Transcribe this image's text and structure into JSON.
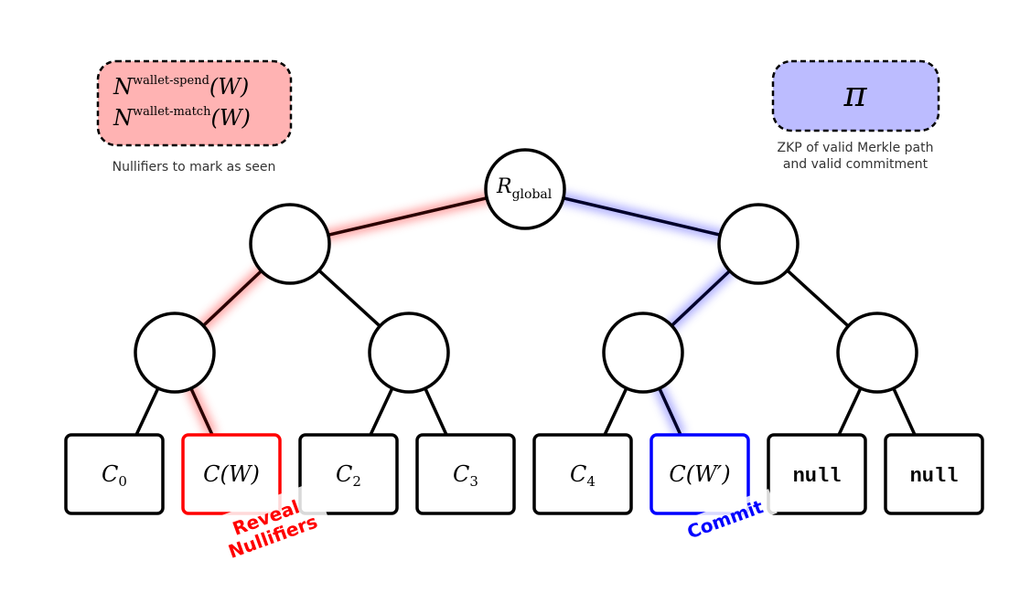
{
  "root": {
    "label_main": "R",
    "label_sub": "global"
  },
  "nullifier_box": {
    "lines": [
      {
        "base": "N",
        "sup": "wallet-spend",
        "arg": "(W)"
      },
      {
        "base": "N",
        "sup": "wallet-match",
        "arg": "(W)"
      }
    ],
    "caption": "Nullifiers to mark as seen",
    "fill": "#ffb3b3"
  },
  "proof_box": {
    "symbol": "π",
    "caption_lines": [
      "ZKP of valid Merkle path",
      "and valid commitment"
    ],
    "fill": "#bcbcff"
  },
  "leaves": [
    {
      "main": "C",
      "sub": "0",
      "style": "math",
      "highlight": "none"
    },
    {
      "main": "C(W)",
      "sub": "",
      "style": "math",
      "highlight": "red"
    },
    {
      "main": "C",
      "sub": "2",
      "style": "math",
      "highlight": "none"
    },
    {
      "main": "C",
      "sub": "3",
      "style": "math",
      "highlight": "none"
    },
    {
      "main": "C",
      "sub": "4",
      "style": "math",
      "highlight": "none"
    },
    {
      "main": "C(W′)",
      "sub": "",
      "style": "math",
      "highlight": "blue"
    },
    {
      "main": "null",
      "sub": "",
      "style": "mono",
      "highlight": "none"
    },
    {
      "main": "null",
      "sub": "",
      "style": "mono",
      "highlight": "none"
    }
  ],
  "annotations": {
    "reveal": [
      "Reveal",
      "Nullifiers"
    ],
    "commit": "Commit"
  },
  "colors": {
    "red": "#ff0000",
    "blue": "#0000ff",
    "stroke": "#000000"
  }
}
